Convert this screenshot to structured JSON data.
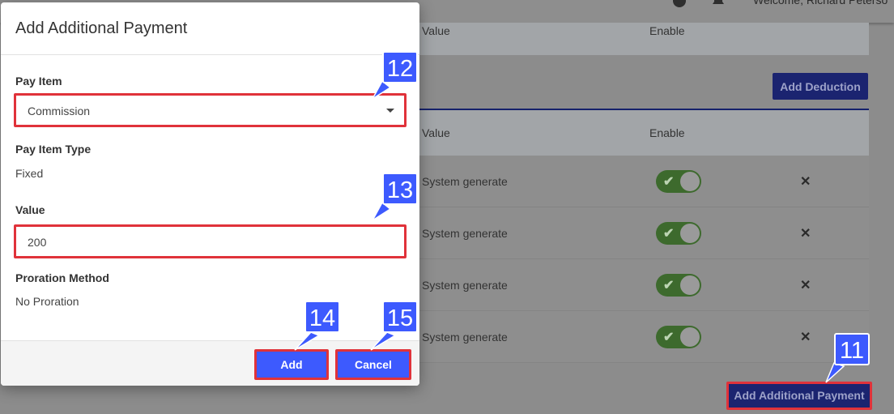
{
  "header": {
    "welcome_text": "Welcome, Richard Peterso"
  },
  "background": {
    "top_table": {
      "col_value": "Value",
      "col_enable": "Enable"
    },
    "add_deduction_label": "Add Deduction",
    "payments_table": {
      "col_value": "Value",
      "col_enable": "Enable",
      "rows": [
        {
          "value": "System generate",
          "enabled": true
        },
        {
          "value": "System generate",
          "enabled": true
        },
        {
          "value": "System generate",
          "enabled": true
        },
        {
          "value": "System generate",
          "enabled": true
        }
      ]
    },
    "add_additional_payment_label": "Add Additional Payment"
  },
  "modal": {
    "title": "Add Additional Payment",
    "pay_item_label": "Pay Item",
    "pay_item_value": "Commission",
    "pay_item_type_label": "Pay Item Type",
    "pay_item_type_value": "Fixed",
    "value_label": "Value",
    "value_value": "200",
    "proration_label": "Proration Method",
    "proration_value": "No Proration",
    "add_label": "Add",
    "cancel_label": "Cancel"
  },
  "callouts": {
    "c11": "11",
    "c12": "12",
    "c13": "13",
    "c14": "14",
    "c15": "15"
  },
  "colors": {
    "accent": "#3d5afe",
    "highlight": "#e0323a",
    "dark_button": "#1b2470"
  }
}
